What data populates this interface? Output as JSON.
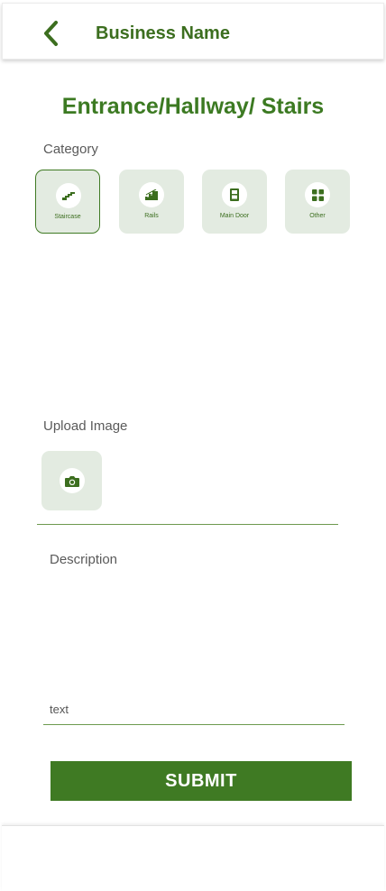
{
  "header": {
    "title": "Business Name",
    "back_icon": "chevron-left-icon"
  },
  "page": {
    "title": "Entrance/Hallway/ Stairs"
  },
  "category": {
    "label": "Category",
    "items": [
      {
        "label": "Staircase",
        "icon": "stairs-icon",
        "selected": true
      },
      {
        "label": "Rails",
        "icon": "rails-icon",
        "selected": false
      },
      {
        "label": "Main Door",
        "icon": "door-icon",
        "selected": false
      },
      {
        "label": "Other",
        "icon": "grid-icon",
        "selected": false
      }
    ]
  },
  "upload": {
    "label": "Upload Image",
    "icon": "camera-icon"
  },
  "description": {
    "label": "Description",
    "placeholder": "text"
  },
  "submit": {
    "label": "SUBMIT"
  },
  "colors": {
    "accent": "#3f7a23",
    "tile": "#e3ebe1",
    "title": "#3c7a22"
  }
}
